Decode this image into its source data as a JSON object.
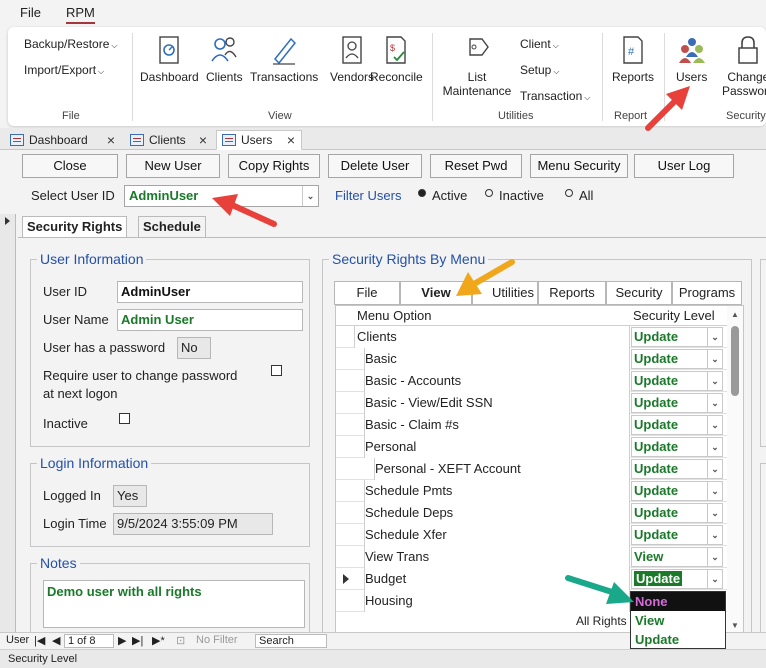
{
  "menubar": {
    "file": "File",
    "rpm": "RPM"
  },
  "ribbon": {
    "file_group": {
      "backup_restore": "Backup/Restore",
      "import_export": "Import/Export",
      "label": "File"
    },
    "view_group": {
      "items": [
        "Dashboard",
        "Clients",
        "Transactions",
        "Vendors",
        "Reconcile"
      ],
      "label": "View"
    },
    "utilities_group": {
      "list_line1": "List",
      "list_line2": "Maintenance",
      "client": "Client",
      "setup": "Setup",
      "transaction": "Transaction",
      "label": "Utilities"
    },
    "reports_group": {
      "reports": "Reports",
      "label": "Report"
    },
    "security_group": {
      "users": "Users",
      "change_line1": "Change",
      "change_line2": "Password",
      "label": "Security"
    }
  },
  "doc_tabs": [
    "Dashboard",
    "Clients",
    "Users"
  ],
  "form_buttons": [
    "Close",
    "New User",
    "Copy Rights",
    "Delete User",
    "Reset Pwd",
    "Menu Security",
    "User Log"
  ],
  "select_user": {
    "label": "Select User ID",
    "value": "AdminUser"
  },
  "filter": {
    "label": "Filter Users",
    "options": [
      "Active",
      "Inactive",
      "All"
    ],
    "selected": "Active"
  },
  "inner_tabs": [
    "Security Rights",
    "Schedule"
  ],
  "user_info": {
    "legend": "User Information",
    "user_id_label": "User ID",
    "user_id": "AdminUser",
    "user_name_label": "User Name",
    "user_name": "Admin User",
    "has_password_label": "User has a password",
    "has_password": "No",
    "require_change_line1": "Require user to change password",
    "require_change_line2": "at next logon",
    "inactive_label": "Inactive"
  },
  "login_info": {
    "legend": "Login Information",
    "logged_in_label": "Logged In",
    "logged_in": "Yes",
    "login_time_label": "Login Time",
    "login_time": "9/5/2024 3:55:09 PM"
  },
  "notes": {
    "legend": "Notes",
    "text": "Demo user with all rights"
  },
  "rights": {
    "legend": "Security Rights By Menu",
    "tabs": [
      "File",
      "View",
      "Utilities",
      "Reports",
      "Security",
      "Programs"
    ],
    "active_tab": "View",
    "col_option": "Menu Option",
    "col_level": "Security Level",
    "rows": [
      {
        "name": "Clients",
        "indent": 0,
        "level": "Update"
      },
      {
        "name": "Basic",
        "indent": 1,
        "level": "Update"
      },
      {
        "name": "Basic - Accounts",
        "indent": 1,
        "level": "Update"
      },
      {
        "name": "Basic - View/Edit SSN",
        "indent": 1,
        "level": "Update"
      },
      {
        "name": "Basic - Claim #s",
        "indent": 1,
        "level": "Update"
      },
      {
        "name": "Personal",
        "indent": 1,
        "level": "Update"
      },
      {
        "name": "Personal - XEFT Account",
        "indent": 2,
        "level": "Update"
      },
      {
        "name": "Schedule Pmts",
        "indent": 1,
        "level": "Update"
      },
      {
        "name": "Schedule Deps",
        "indent": 1,
        "level": "Update"
      },
      {
        "name": "Schedule Xfer",
        "indent": 1,
        "level": "Update"
      },
      {
        "name": "View Trans",
        "indent": 1,
        "level": "View"
      },
      {
        "name": "Budget",
        "indent": 1,
        "level": "Update"
      },
      {
        "name": "Housing",
        "indent": 1,
        "level": ""
      }
    ],
    "current_row": 11,
    "all_rights_label": "All Rights",
    "dropdown_options": [
      "None",
      "View",
      "Update"
    ],
    "dropdown_selected": "None"
  },
  "navbar": {
    "record_label": "User",
    "record_value": "1 of 8",
    "no_filter": "No Filter",
    "search": "Search"
  },
  "status": "Security Level",
  "colors": {
    "accent": "#a4373a",
    "green_text": "#1a7a2a",
    "label_blue": "#2350a8",
    "red_arrow": "#e8413c",
    "orange_arrow": "#f0a71b",
    "teal_arrow": "#1aa88a"
  }
}
